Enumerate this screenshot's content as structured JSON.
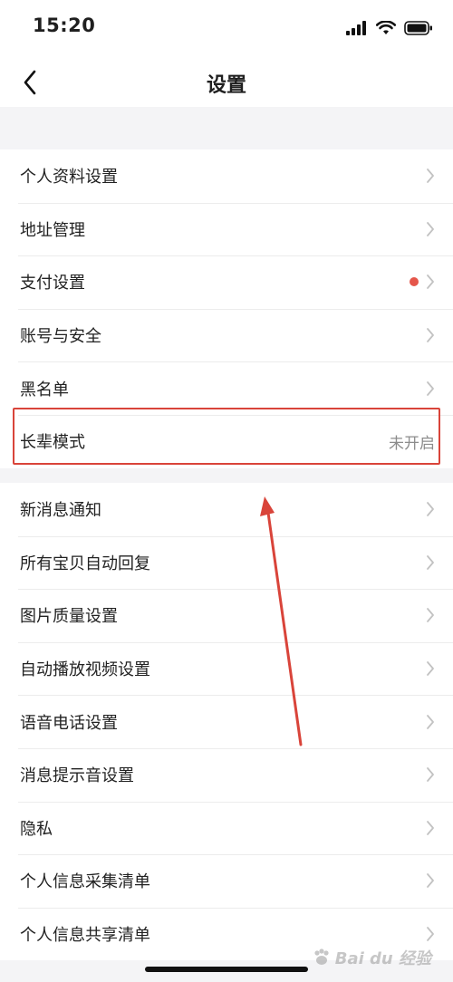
{
  "status_bar": {
    "time": "15:20",
    "icons": [
      "signal-icon",
      "wifi-icon",
      "battery-icon"
    ]
  },
  "nav": {
    "back_icon": "chevron-left-icon",
    "title": "设置"
  },
  "groups": [
    {
      "items": [
        {
          "label": "个人资料设置"
        },
        {
          "label": "地址管理"
        },
        {
          "label": "支付设置",
          "badge": "red-dot"
        },
        {
          "label": "账号与安全"
        },
        {
          "label": "黑名单"
        },
        {
          "label": "长辈模式",
          "value": "未开启",
          "highlighted": true
        }
      ]
    },
    {
      "items": [
        {
          "label": "新消息通知"
        },
        {
          "label": "所有宝贝自动回复"
        },
        {
          "label": "图片质量设置"
        },
        {
          "label": "自动播放视频设置"
        },
        {
          "label": "语音电话设置"
        },
        {
          "label": "消息提示音设置"
        },
        {
          "label": "隐私"
        },
        {
          "label": "个人信息采集清单"
        },
        {
          "label": "个人信息共享清单"
        }
      ]
    }
  ],
  "annotation": {
    "highlight_color": "#d9443a",
    "arrow_color": "#d9443a"
  },
  "watermark": {
    "text": "Bai du 经验"
  },
  "colors": {
    "background": "#f4f4f6",
    "row_background": "#ffffff",
    "badge": "#e5564b",
    "chevron": "#c2c2c2"
  }
}
